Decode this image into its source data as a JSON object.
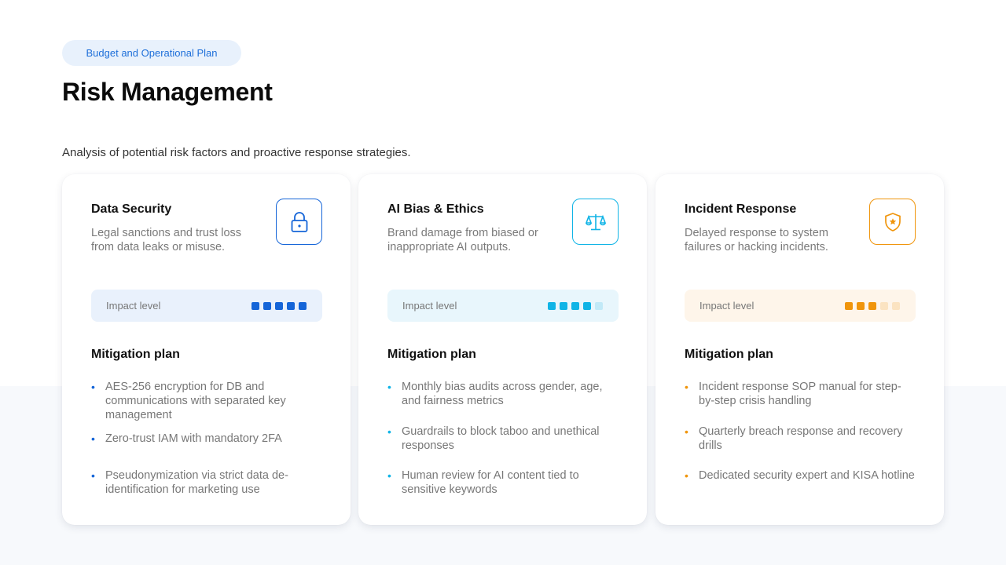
{
  "header": {
    "pill_label": "Budget and Operational Plan",
    "title": "Risk Management",
    "subtitle": "Analysis of potential risk factors and proactive response strategies."
  },
  "cards": [
    {
      "title": "Data Security",
      "description": "Legal sanctions and trust loss from data leaks or misuse.",
      "icon": "lock-icon",
      "accent": "#1565d8",
      "impact_bg": "#e9f1fc",
      "impact_label": "Impact level",
      "impact_level": 5,
      "impact_max": 5,
      "mitigation_title": "Mitigation plan",
      "mitigation": [
        "AES-256 encryption for DB and communications with separated key management",
        "Zero-trust IAM with mandatory 2FA",
        "Pseudonymization via strict data de-identification for marketing use"
      ]
    },
    {
      "title": "AI Bias & Ethics",
      "description": "Brand damage from biased or inappropriate AI outputs.",
      "icon": "scales-icon",
      "accent": "#10b4e6",
      "impact_bg": "#e8f6fc",
      "impact_label": "Impact level",
      "impact_level": 4,
      "impact_max": 5,
      "mitigation_title": "Mitigation plan",
      "mitigation": [
        "Monthly bias audits across gender, age, and fairness metrics",
        "Guardrails to block taboo and unethical responses",
        "Human review for AI content tied to sensitive keywords"
      ]
    },
    {
      "title": "Incident Response",
      "description": "Delayed response to system failures or hacking incidents.",
      "icon": "shield-star-icon",
      "accent": "#f0950c",
      "impact_bg": "#fef5ea",
      "impact_label": "Impact level",
      "impact_level": 3,
      "impact_max": 5,
      "mitigation_title": "Mitigation plan",
      "mitigation": [
        "Incident response SOP manual for step-by-step crisis handling",
        "Quarterly breach response and recovery drills",
        "Dedicated security expert and KISA hotline"
      ]
    }
  ]
}
